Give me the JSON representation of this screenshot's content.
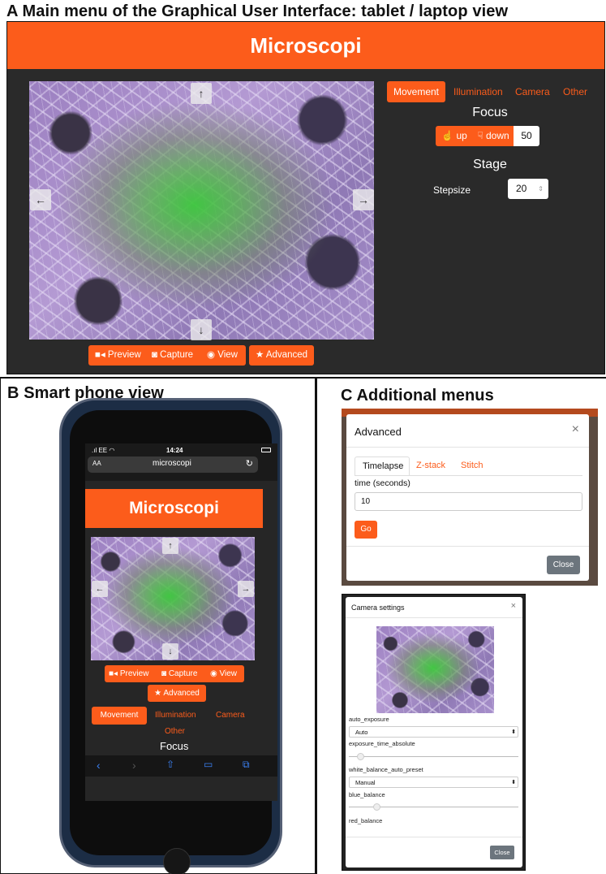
{
  "panels": {
    "a_title": "A Main menu of the Graphical User Interface: tablet / laptop view",
    "b_title": "B Smart phone view",
    "c_title": "C Additional menus"
  },
  "desktop": {
    "app_title": "Microscopi",
    "arrows": {
      "up": "↑",
      "down": "↓",
      "left": "←",
      "right": "→"
    },
    "bottom_buttons": {
      "preview": "Preview",
      "capture": "Capture",
      "view": "View",
      "advanced": "Advanced"
    },
    "tabs": {
      "movement": "Movement",
      "illumination": "Illumination",
      "camera": "Camera",
      "other": "Other"
    },
    "focus": {
      "heading": "Focus",
      "up": "up",
      "down": "down",
      "value": "50"
    },
    "stage": {
      "heading": "Stage",
      "stepsize_label": "Stepsize",
      "stepsize_value": "20"
    }
  },
  "phone": {
    "status": {
      "carrier": "EE",
      "time": "14:24"
    },
    "url_bar": {
      "text_size": "AA",
      "url": "microscopi"
    },
    "app_title": "Microscopi",
    "buttons": {
      "preview": "Preview",
      "capture": "Capture",
      "view": "View",
      "advanced": "Advanced"
    },
    "tabs": {
      "movement": "Movement",
      "illumination": "Illumination",
      "camera": "Camera",
      "other": "Other"
    },
    "focus_heading": "Focus"
  },
  "advanced_modal": {
    "title": "Advanced",
    "close_x": "×",
    "tabs": [
      "Timelapse",
      "Z-stack",
      "Stitch"
    ],
    "field_label": "time (seconds)",
    "field_value": "10",
    "go_label": "Go",
    "close_label": "Close"
  },
  "camera_modal": {
    "title": "Camera settings",
    "close_x": "×",
    "auto_exposure_label": "auto_exposure",
    "auto_exposure_value": "Auto",
    "exposure_time_label": "exposure_time_absolute",
    "exposure_time_level": 0.05,
    "wb_preset_label": "white_balance_auto_preset",
    "wb_preset_value": "Manual",
    "blue_balance_label": "blue_balance",
    "blue_balance_level": 0.15,
    "red_balance_label": "red_balance",
    "close_label": "Close"
  },
  "colors": {
    "accent": "#fc5c1b",
    "dark_bg": "#2a2a2a",
    "close_button": "#6c757d"
  }
}
